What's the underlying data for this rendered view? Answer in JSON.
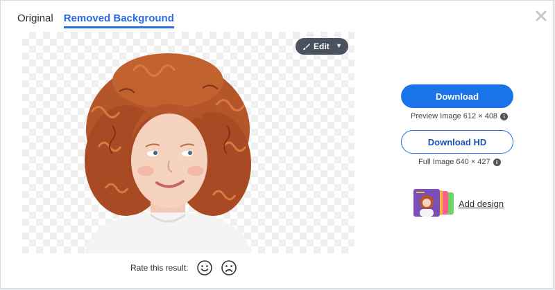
{
  "tabs": [
    {
      "label": "Original",
      "active": false
    },
    {
      "label": "Removed Background",
      "active": true
    }
  ],
  "editor": {
    "edit_label": "Edit",
    "rate_label": "Rate this result:"
  },
  "downloads": {
    "download_label": "Download",
    "preview_info": "Preview Image 612 × 408",
    "download_hd_label": "Download HD",
    "full_info": "Full Image 640 × 427"
  },
  "design": {
    "add_label": "Add design"
  },
  "icons": [
    "close-icon",
    "brush-icon",
    "caret-down-icon",
    "smile-icon",
    "frown-icon",
    "info-icon"
  ],
  "colors": {
    "accent": "#1a73e8",
    "tab_active": "#2b6be8",
    "edit_bg": "#4a5260"
  }
}
